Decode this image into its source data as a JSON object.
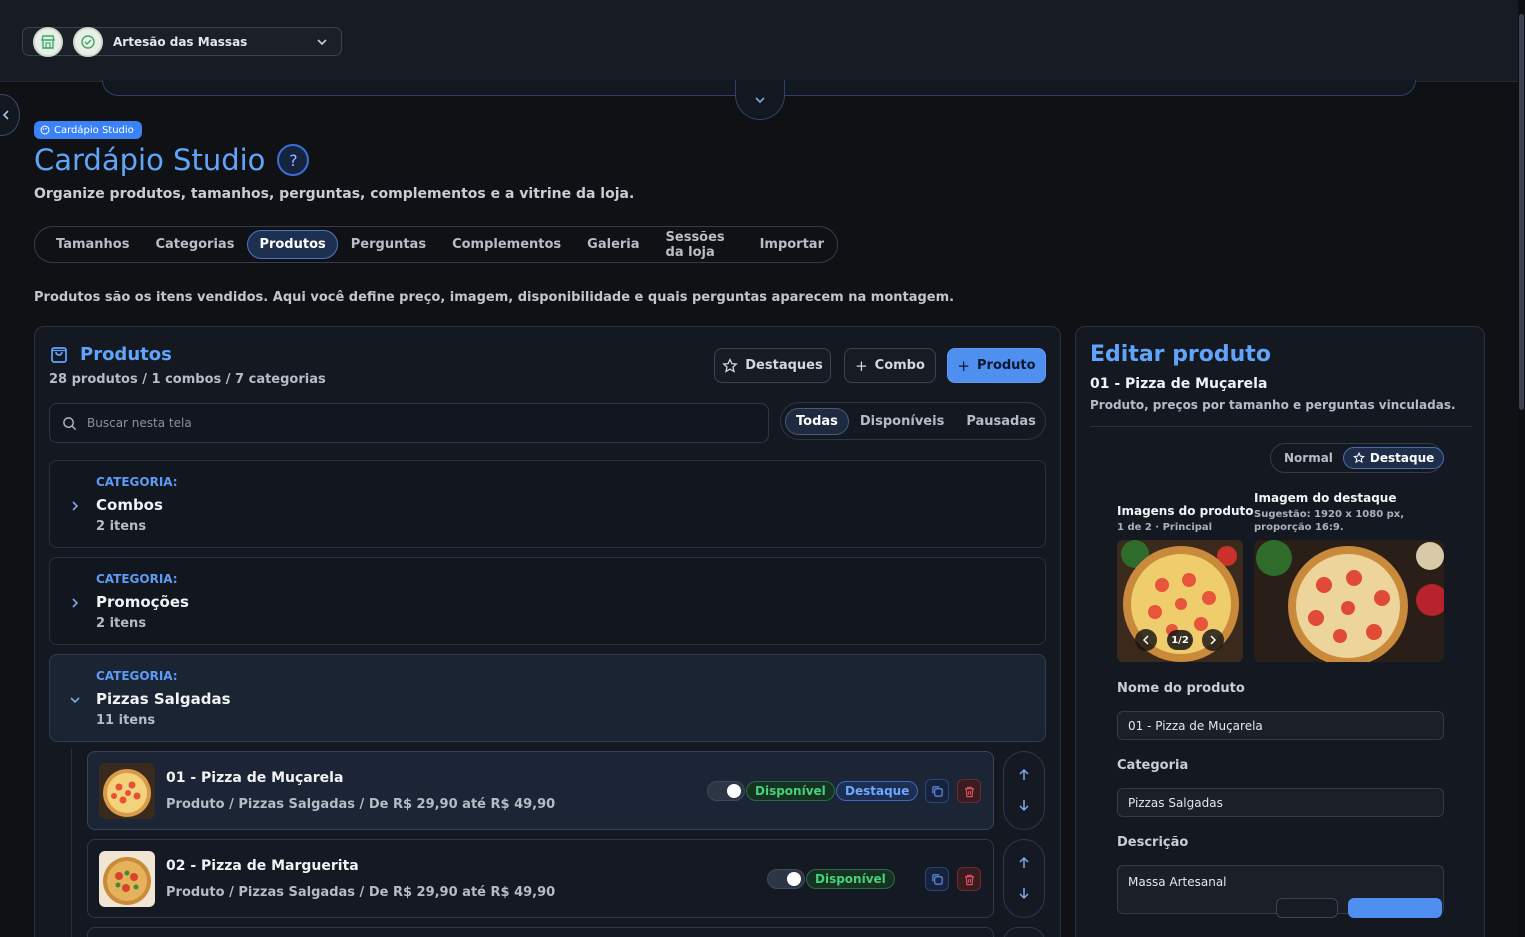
{
  "store": {
    "name": "Artesão das Massas"
  },
  "header": {
    "badge": "Cardápio Studio",
    "title": "Cardápio Studio",
    "help": "?",
    "subtitle": "Organize produtos, tamanhos, perguntas, complementos e a vitrine da loja."
  },
  "tabs": [
    {
      "label": "Tamanhos"
    },
    {
      "label": "Categorias"
    },
    {
      "label": "Produtos",
      "active": true
    },
    {
      "label": "Perguntas"
    },
    {
      "label": "Complementos"
    },
    {
      "label": "Galeria"
    },
    {
      "label": "Sessões da loja"
    },
    {
      "label": "Importar"
    }
  ],
  "info_text": "Produtos são os itens vendidos. Aqui você define preço, imagem, disponibilidade e quais perguntas aparecem na montagem.",
  "products_panel": {
    "title": "Produtos",
    "summary": "28 produtos / 1 combos / 7 categorias",
    "btn_highlights": "Destaques",
    "btn_combo": "Combo",
    "btn_product": "Produto",
    "search_placeholder": "Buscar nesta tela",
    "filters": [
      {
        "label": "Todas",
        "active": true
      },
      {
        "label": "Disponíveis"
      },
      {
        "label": "Pausadas"
      }
    ],
    "categories": [
      {
        "label": "CATEGORIA:",
        "name": "Combos",
        "count": "2 itens",
        "open": false
      },
      {
        "label": "CATEGORIA:",
        "name": "Promoções",
        "count": "2 itens",
        "open": false
      },
      {
        "label": "CATEGORIA:",
        "name": "Pizzas Salgadas",
        "count": "11 itens",
        "open": true
      }
    ],
    "products": [
      {
        "name": "01 - Pizza de Muçarela",
        "meta": "Produto / Pizzas Salgadas / De R$ 29,90 até R$ 49,90",
        "status": "Disponível",
        "highlight": "Destaque"
      },
      {
        "name": "02 - Pizza de Marguerita",
        "meta": "Produto / Pizzas Salgadas / De R$ 29,90 até R$ 49,90",
        "status": "Disponível"
      }
    ]
  },
  "edit_panel": {
    "title": "Editar produto",
    "product_name": "01 - Pizza de Muçarela",
    "subtitle": "Produto, preços por tamanho e perguntas vinculadas.",
    "modes": [
      {
        "label": "Normal"
      },
      {
        "label": "Destaque",
        "active": true
      }
    ],
    "images_label": "Imagens do produto",
    "images_note": "1 de 2 · Principal",
    "carousel_count": "1/2",
    "highlight_image_label": "Imagem do destaque",
    "highlight_image_note_1": "Sugestão: 1920 x 1080 px,",
    "highlight_image_note_2": "proporção 16:9.",
    "name_label": "Nome do produto",
    "name_value": "01 - Pizza de Muçarela",
    "category_label": "Categoria",
    "category_value": "Pizzas Salgadas",
    "description_label": "Descrição",
    "description_value": "Massa Artesanal"
  },
  "colors": {
    "accent": "#60a5fa",
    "primary_button": "#4e8ff0",
    "available": "#46d17c",
    "danger": "#e05260"
  }
}
